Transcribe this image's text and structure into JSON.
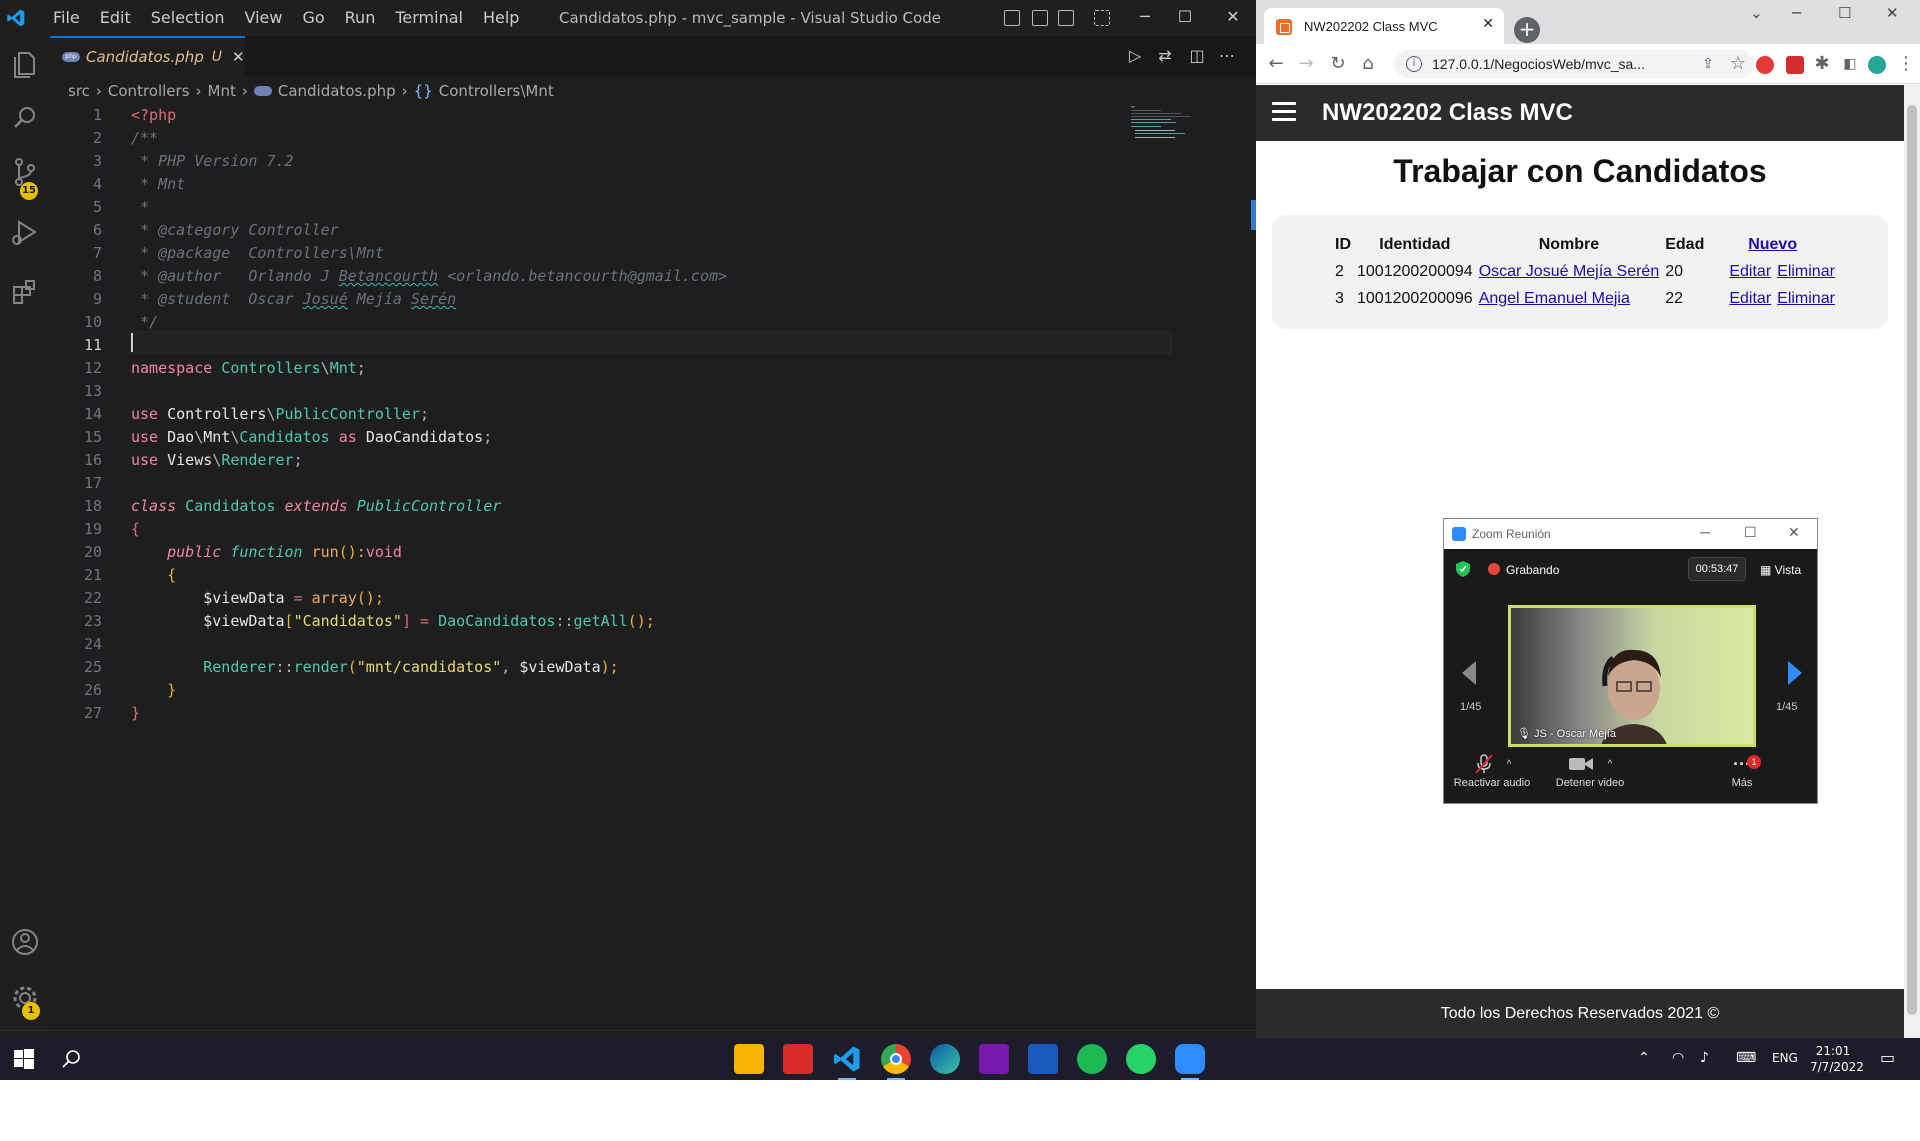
{
  "vscode": {
    "menu": [
      "File",
      "Edit",
      "Selection",
      "View",
      "Go",
      "Run",
      "Terminal",
      "Help"
    ],
    "window_title": "Candidatos.php - mvc_sample - Visual Studio Code",
    "tab": {
      "name": "Candidatos.php",
      "status": "U",
      "close": "✕"
    },
    "breadcrumb": [
      "src",
      "Controllers",
      "Mnt",
      "Candidatos.php",
      "Controllers\\Mnt"
    ],
    "activity_badges": {
      "source_control": "15",
      "settings": "1"
    },
    "current_line": 11,
    "code_lines": [
      "1",
      "2",
      "3",
      "4",
      "5",
      "6",
      "7",
      "8",
      "9",
      "10",
      "11",
      "12",
      "13",
      "14",
      "15",
      "16",
      "17",
      "18",
      "19",
      "20",
      "21",
      "22",
      "23",
      "24",
      "25",
      "26",
      "27"
    ],
    "code": {
      "l1": "<?php",
      "l2": "/**",
      "l3": " * PHP Version 7.2",
      "l4": " * Mnt",
      "l5": " *",
      "l6": " * @category Controller",
      "l7": " * @package  Controllers\\Mnt",
      "l8a": " * @author   Orlando J ",
      "l8b": "Betancourth",
      "l8c": " <orlando.betancourth@gmail.com>",
      "l9a": " * @student  Oscar ",
      "l9b": "Josué",
      "l9c": " Mejía ",
      "l9d": "Serén",
      "l10": " */",
      "l12a": "namespace",
      "l12b": " Controllers",
      "l12c": "\\",
      "l12d": "Mnt",
      "l12e": ";",
      "l14a": "use",
      "l14b": " Controllers",
      "l14c": "\\",
      "l14d": "PublicController",
      "l14e": ";",
      "l15a": "use",
      "l15b": " Dao",
      "l15c": "\\",
      "l15d": "Mnt",
      "l15e": "\\",
      "l15f": "Candidatos",
      "l15g": " as ",
      "l15h": "DaoCandidatos",
      "l15i": ";",
      "l16a": "use",
      "l16b": " Views",
      "l16c": "\\",
      "l16d": "Renderer",
      "l16e": ";",
      "l18a": "class",
      "l18b": " Candidatos ",
      "l18c": "extends",
      "l18d": " PublicController",
      "l19": "{",
      "l20a": "    public ",
      "l20b": "function",
      "l20c": " run",
      "l20d": "():",
      "l20e": "void",
      "l21": "    {",
      "l22a": "        $viewData",
      "l22b": " = ",
      "l22c": "array",
      "l22d": "();",
      "l23a": "        $viewData",
      "l23b": "[",
      "l23c": "\"Candidatos\"",
      "l23d": "] = ",
      "l23e": "DaoCandidatos",
      "l23f": "::",
      "l23g": "getAll",
      "l23h": "();",
      "l25a": "        Renderer",
      "l25b": "::",
      "l25c": "render",
      "l25d": "(",
      "l25e": "\"mnt/candidatos\"",
      "l25f": ", ",
      "l25g": "$viewData",
      "l25h": ");",
      "l26": "    }",
      "l27": "}"
    }
  },
  "browser": {
    "tab_title": "NW202202 Class MVC",
    "url": "127.0.0.1/NegociosWeb/mvc_sa...",
    "page": {
      "brand": "NW202202 Class MVC",
      "title": "Trabajar con Candidatos",
      "table": {
        "headers": [
          "ID",
          "Identidad",
          "Nombre",
          "Edad"
        ],
        "new_link": "Nuevo",
        "rows": [
          {
            "id": "2",
            "identidad": "1001200200094",
            "nombre": "Oscar Josué Mejía Serén",
            "edad": "20",
            "edit": "Editar",
            "delete": "Eliminar"
          },
          {
            "id": "3",
            "identidad": "1001200200096",
            "nombre": "Angel Emanuel Mejia",
            "edad": "22",
            "edit": "Editar",
            "delete": "Eliminar"
          }
        ]
      },
      "footer": "Todo los Derechos Reservados 2021 ©"
    }
  },
  "zoom": {
    "title": "Zoom Reunión",
    "recording": "Grabando",
    "timer": "00:53:47",
    "view": "Vista",
    "participant": "JS - Oscar Mejía",
    "page_left": "1/45",
    "page_right": "1/45",
    "controls": {
      "audio": "Reactivar audio",
      "video": "Detener video",
      "more": "Más",
      "more_badge": "1"
    }
  },
  "taskbar": {
    "lang": "ENG",
    "time": "21:01",
    "date": "7/7/2022"
  },
  "colors": {
    "vscode_bg": "#1e1e1e",
    "accent": "#0078d4",
    "link": "#1a0dab",
    "page_header": "#2b2b2b"
  }
}
